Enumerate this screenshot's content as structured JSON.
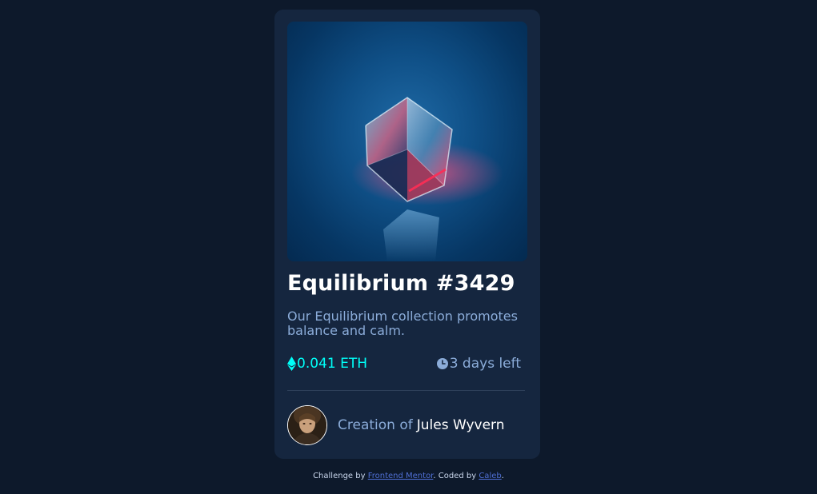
{
  "card": {
    "image_alt": "Equilibrium crystal cube",
    "title": "Equilibrium #3429",
    "description": "Our Equilibrium collection promotes balance and calm.",
    "price": "0.041 ETH",
    "price_icon": "ethereum-icon",
    "time_left": "3 days left",
    "time_icon": "clock-icon",
    "creator_prefix": "Creation of",
    "creator_name": "Jules Wyvern"
  },
  "footer": {
    "challenge_by": "Challenge by",
    "frontend_mentor": "Frontend Mentor",
    "coded_by": ". Coded by",
    "author": "Caleb",
    "end": "."
  },
  "colors": {
    "page_bg": "#0d192b",
    "card_bg": "#15263f",
    "accent_cyan": "#00fff8",
    "soft_blue": "#8bacd9",
    "link": "#4f6fd4",
    "white": "#ffffff"
  }
}
